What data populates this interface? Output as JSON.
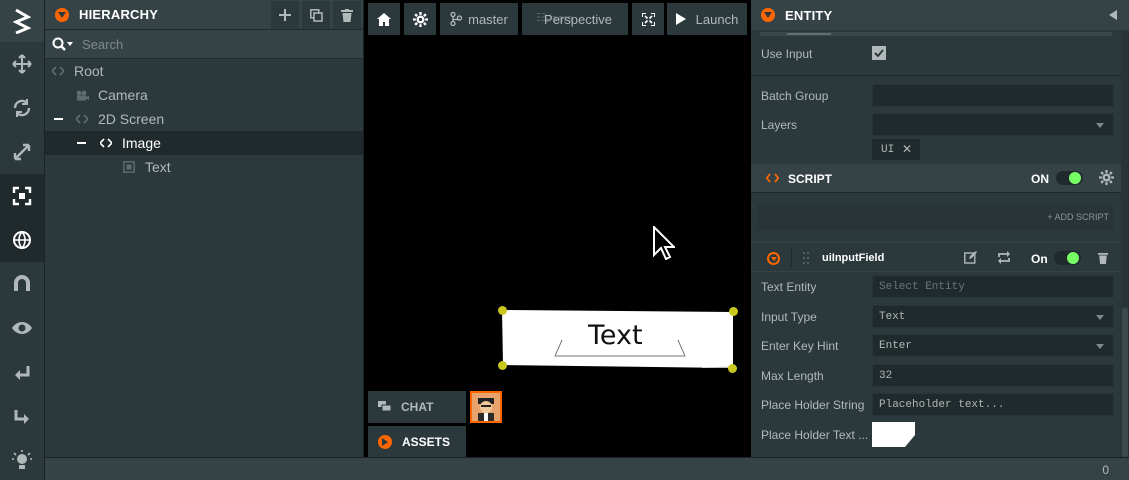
{
  "hierarchy": {
    "title": "HIERARCHY",
    "search_placeholder": "Search",
    "tree": [
      {
        "label": "Root",
        "icon": "entity-icon"
      },
      {
        "label": "Camera",
        "icon": "camera-icon"
      },
      {
        "label": "2D Screen",
        "icon": "entity-icon"
      },
      {
        "label": "Image",
        "icon": "entity-icon"
      },
      {
        "label": "Text",
        "icon": "element-icon"
      }
    ]
  },
  "viewport": {
    "home_label": "",
    "branch": "master",
    "camera": "Perspective",
    "camera_overlay": "Users",
    "launch": "Launch",
    "text_element": "Text",
    "chat_tab": "CHAT",
    "assets_tab": "ASSETS"
  },
  "entity": {
    "title": "ENTITY",
    "use_input_label": "Use Input",
    "use_input_checked": true,
    "batch_group_label": "Batch Group",
    "layers_label": "Layers",
    "layer_tag": "UI",
    "script_section": {
      "title": "SCRIPT",
      "state": "ON",
      "add_script": "+ ADD SCRIPT"
    },
    "script_item": {
      "name": "uiInputField",
      "state": "On"
    },
    "fields": [
      {
        "label": "Text Entity",
        "value": "Select Entity",
        "placeholder": true,
        "dropdown": false
      },
      {
        "label": "Input Type",
        "value": "Text",
        "dropdown": true
      },
      {
        "label": "Enter Key Hint",
        "value": "Enter",
        "dropdown": true
      },
      {
        "label": "Max Length",
        "value": "32",
        "dropdown": false
      },
      {
        "label": "Place Holder String",
        "value": "Placeholder text...",
        "dropdown": false
      },
      {
        "label": "Place Holder Text ...",
        "value": "",
        "dropdown": false,
        "color": "#ffffff"
      }
    ]
  },
  "status": {
    "count": "0"
  },
  "colors": {
    "accent": "#ff6600",
    "toggle_on": "#77ff66",
    "gizmo": "#c8c81e"
  }
}
